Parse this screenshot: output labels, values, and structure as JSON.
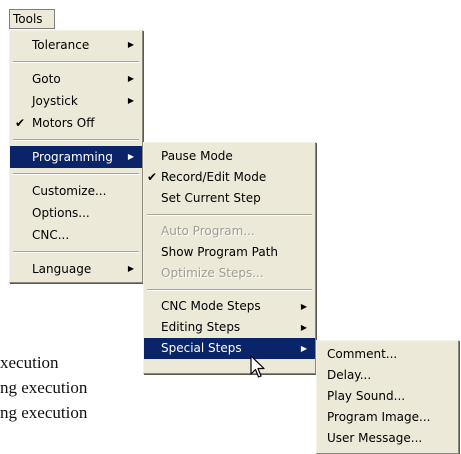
{
  "background_text": {
    "line1": "xecution",
    "line2": "ng execution",
    "line3": "ng execution"
  },
  "menubar": {
    "tools": "Tools"
  },
  "tools_menu": {
    "items": [
      {
        "label": "Tolerance",
        "submenu": true
      },
      {
        "label": "Goto",
        "submenu": true
      },
      {
        "label": "Joystick",
        "submenu": true
      },
      {
        "label": "Motors Off",
        "checked": true
      },
      {
        "label": "Programming",
        "submenu": true,
        "active": true
      },
      {
        "label": "Customize..."
      },
      {
        "label": "Options..."
      },
      {
        "label": "CNC..."
      },
      {
        "label": "Language",
        "submenu": true
      }
    ]
  },
  "programming_menu": {
    "items": [
      {
        "label": "Pause Mode"
      },
      {
        "label": "Record/Edit Mode",
        "checked": true
      },
      {
        "label": "Set Current Step"
      },
      {
        "label": "Auto Program...",
        "disabled": true
      },
      {
        "label": "Show Program Path"
      },
      {
        "label": "Optimize Steps...",
        "disabled": true
      },
      {
        "label": "CNC Mode Steps",
        "submenu": true
      },
      {
        "label": "Editing Steps",
        "submenu": true
      },
      {
        "label": "Special Steps",
        "submenu": true,
        "active": true
      }
    ]
  },
  "special_steps_menu": {
    "items": [
      {
        "label": "Comment..."
      },
      {
        "label": "Delay..."
      },
      {
        "label": "Play Sound..."
      },
      {
        "label": "Program Image..."
      },
      {
        "label": "User Message..."
      }
    ]
  },
  "icons": {
    "check": "checkmark-icon",
    "submenu_arrow": "submenu-arrow-icon",
    "cursor": "mouse-pointer-icon"
  },
  "colors": {
    "menu_bg": "#ece9d8",
    "highlight_bg": "#0a246a",
    "highlight_text": "#ffffff",
    "disabled_text": "#9e9c94"
  }
}
